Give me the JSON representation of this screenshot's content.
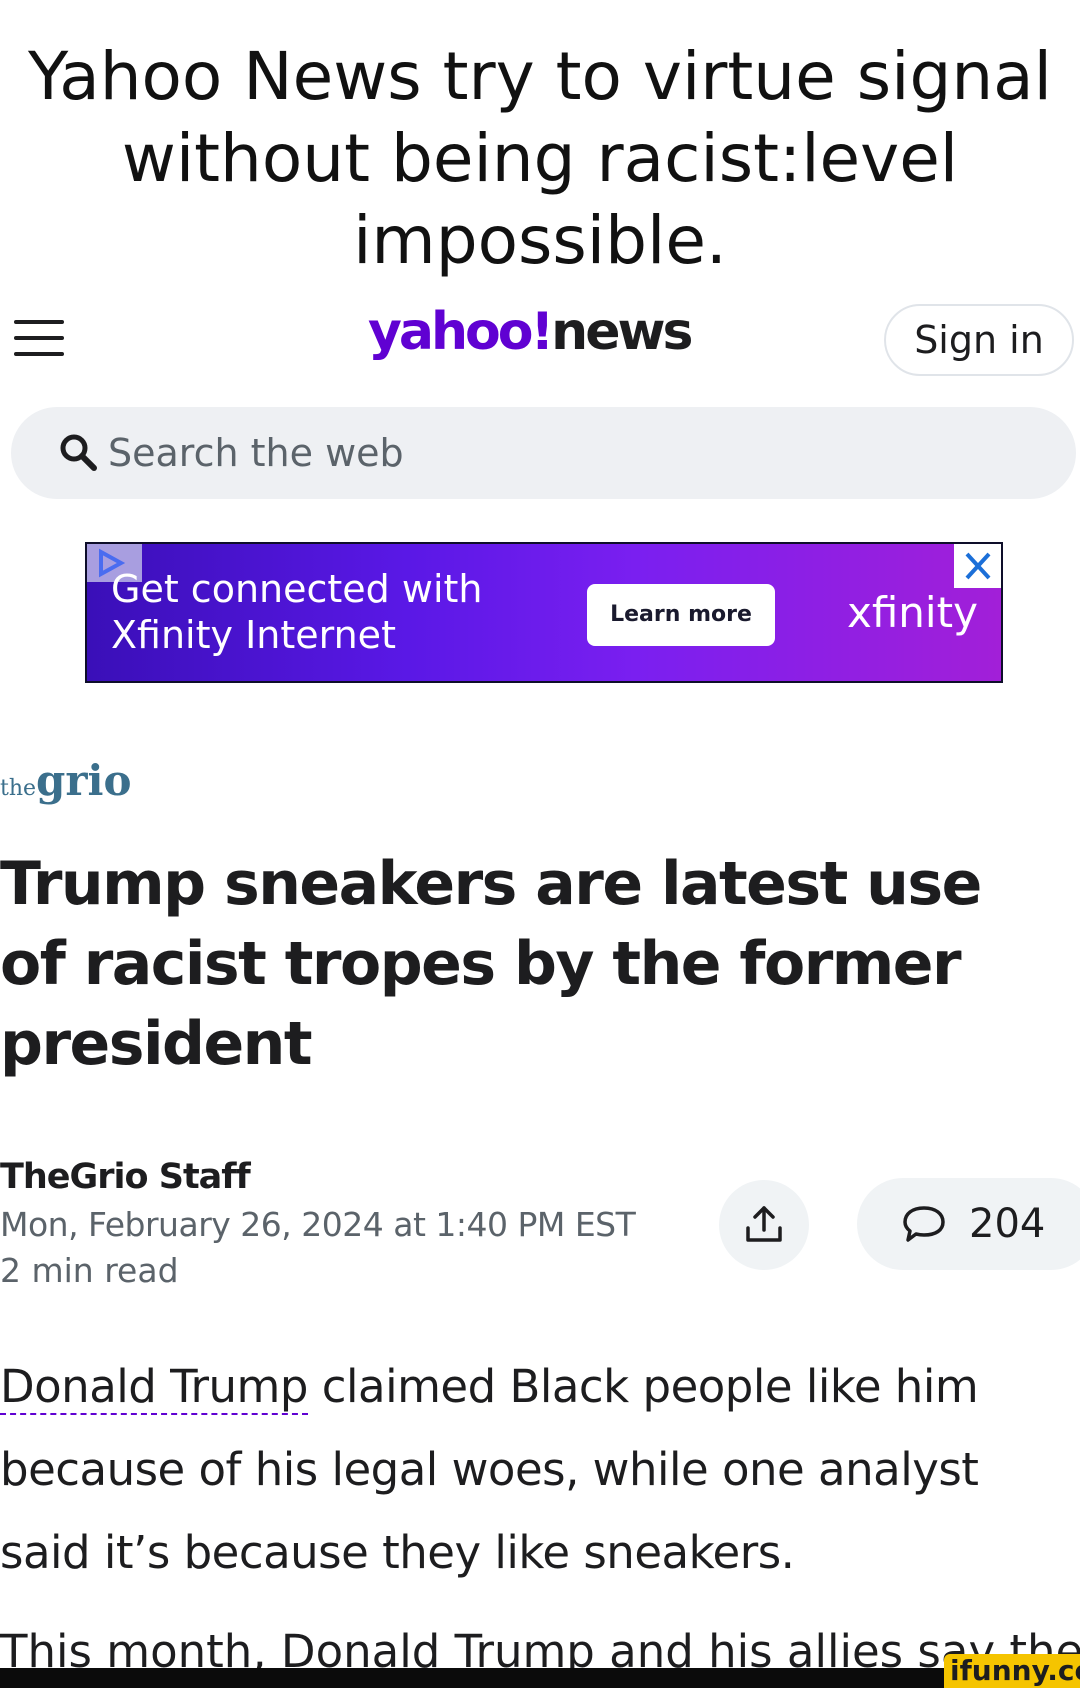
{
  "caption": {
    "lines": [
      "Yahoo News try to virtue signal",
      "without being racist:level",
      "impossible."
    ]
  },
  "header": {
    "logo_brand": "yahoo!",
    "logo_product": "news",
    "signin_label": "Sign in"
  },
  "search": {
    "placeholder": "Search the web"
  },
  "ad": {
    "headline_line1": "Get connected with",
    "headline_line2": "Xfinity Internet",
    "cta_label": "Learn more",
    "brand": "xfinity"
  },
  "article": {
    "source_logo_prefix": "the",
    "source_logo_name": "grio",
    "headline": "Trump sneakers are latest use of racist tropes by the former president",
    "author": "TheGrio Staff",
    "date": "Mon, February 26, 2024 at 1:40 PM EST",
    "read_time": "2 min read",
    "comment_count": "204",
    "body_link": "Donald Trump",
    "body_rest": " claimed Black people like him because of his legal woes, while one analyst said it’s because they like sneakers.",
    "next_line": "This month, Donald Trump and his allies say the"
  },
  "watermark": "ifunny.co",
  "colors": {
    "brand_purple": "#6001d2",
    "text_primary": "#1d1d1f",
    "text_secondary": "#5b636a",
    "search_bg": "#eef0f3",
    "ad_gradient_start": "#3a0fb8",
    "ad_gradient_end": "#a21fd8"
  },
  "icons": {
    "menu": "hamburger-menu-icon",
    "search": "magnifier-icon",
    "ad_choices": "ad-choices-icon",
    "close": "close-icon",
    "share": "share-upload-icon",
    "comments": "speech-bubble-icon"
  }
}
